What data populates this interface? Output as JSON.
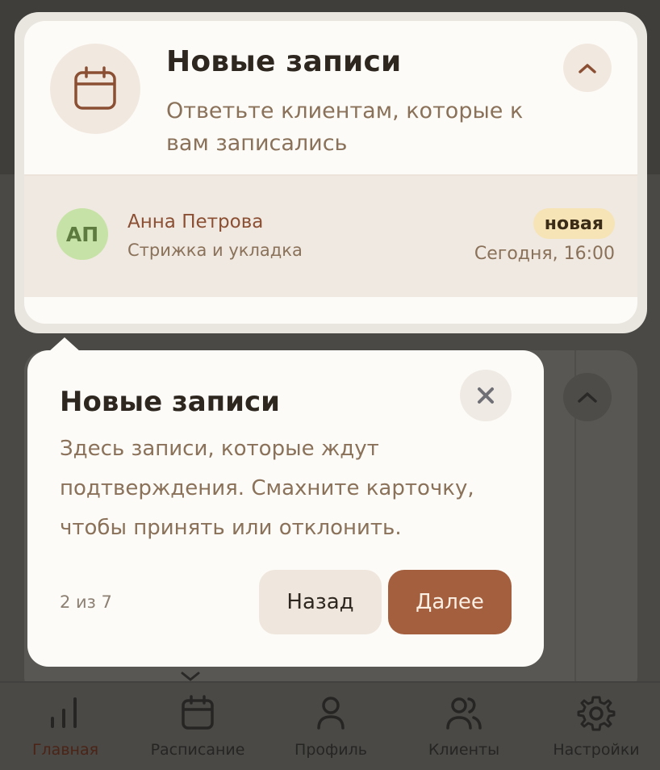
{
  "highlighted_card": {
    "title": "Новые записи",
    "subtitle": "Ответьте клиентам, которые к вам записались",
    "icon": "calendar-icon",
    "collapse_icon": "chevron-up-icon"
  },
  "booking": {
    "initials": "АП",
    "client_name": "Анна Петрова",
    "service": "Стрижка и укладка",
    "status": "новая",
    "time": "Сегодня, 16:00"
  },
  "tooltip": {
    "title": "Новые записи",
    "body": "Здесь записи, которые ждут подтверждения. Смахните карточку, чтобы принять или отклонить.",
    "step": "2 из 7",
    "back_label": "Назад",
    "next_label": "Далее",
    "close_icon": "close-icon"
  },
  "bottom_nav": {
    "items": [
      {
        "label": "Главная",
        "icon": "bar-chart-icon",
        "active": true
      },
      {
        "label": "Расписание",
        "icon": "calendar-icon",
        "active": false
      },
      {
        "label": "Профиль",
        "icon": "user-icon",
        "active": false
      },
      {
        "label": "Клиенты",
        "icon": "users-icon",
        "active": false
      },
      {
        "label": "Настройки",
        "icon": "gear-icon",
        "active": false
      }
    ]
  },
  "colors": {
    "accent": "#a45f3f",
    "title": "#2e2720",
    "muted_text": "#8a7159",
    "badge_bg": "#f6e4b6",
    "avatar_bg": "#c7e2a6",
    "overlay": "#4a4946"
  }
}
